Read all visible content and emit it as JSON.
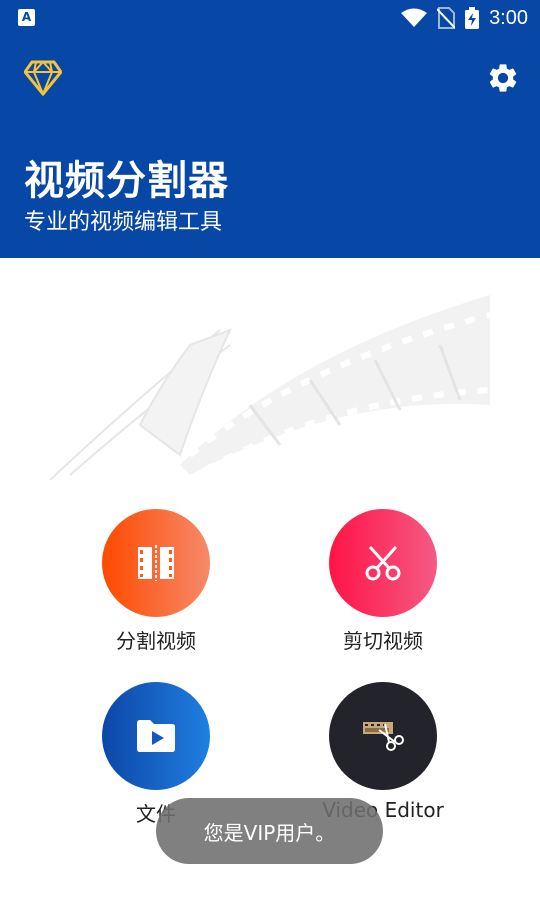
{
  "status_bar": {
    "time": "3:00",
    "icons": [
      "notification-a-icon",
      "wifi-icon",
      "no-sim-icon",
      "battery-charging-icon"
    ]
  },
  "header": {
    "title": "视频分割器",
    "subtitle": "专业的视频编辑工具",
    "vip_icon": "diamond-icon",
    "settings_icon": "gear-icon"
  },
  "features": [
    {
      "label": "分割视频",
      "icon": "split-film-icon",
      "color_from": "#ff4a00",
      "color_to": "#f68a6a"
    },
    {
      "label": "剪切视频",
      "icon": "scissors-icon",
      "color_from": "#ff1446",
      "color_to": "#f45a84"
    },
    {
      "label": "文件",
      "icon": "folder-video-icon",
      "color_from": "#0c47a8",
      "color_to": "#1f7fe0"
    },
    {
      "label": "Video Editor",
      "icon": "film-scissors-icon",
      "color_from": "#23232b",
      "color_to": "#23232b"
    }
  ],
  "toast": {
    "text": "您是VIP用户。"
  },
  "colors": {
    "header_bg": "#0747a6",
    "accent_gold": "#f5c33b"
  }
}
